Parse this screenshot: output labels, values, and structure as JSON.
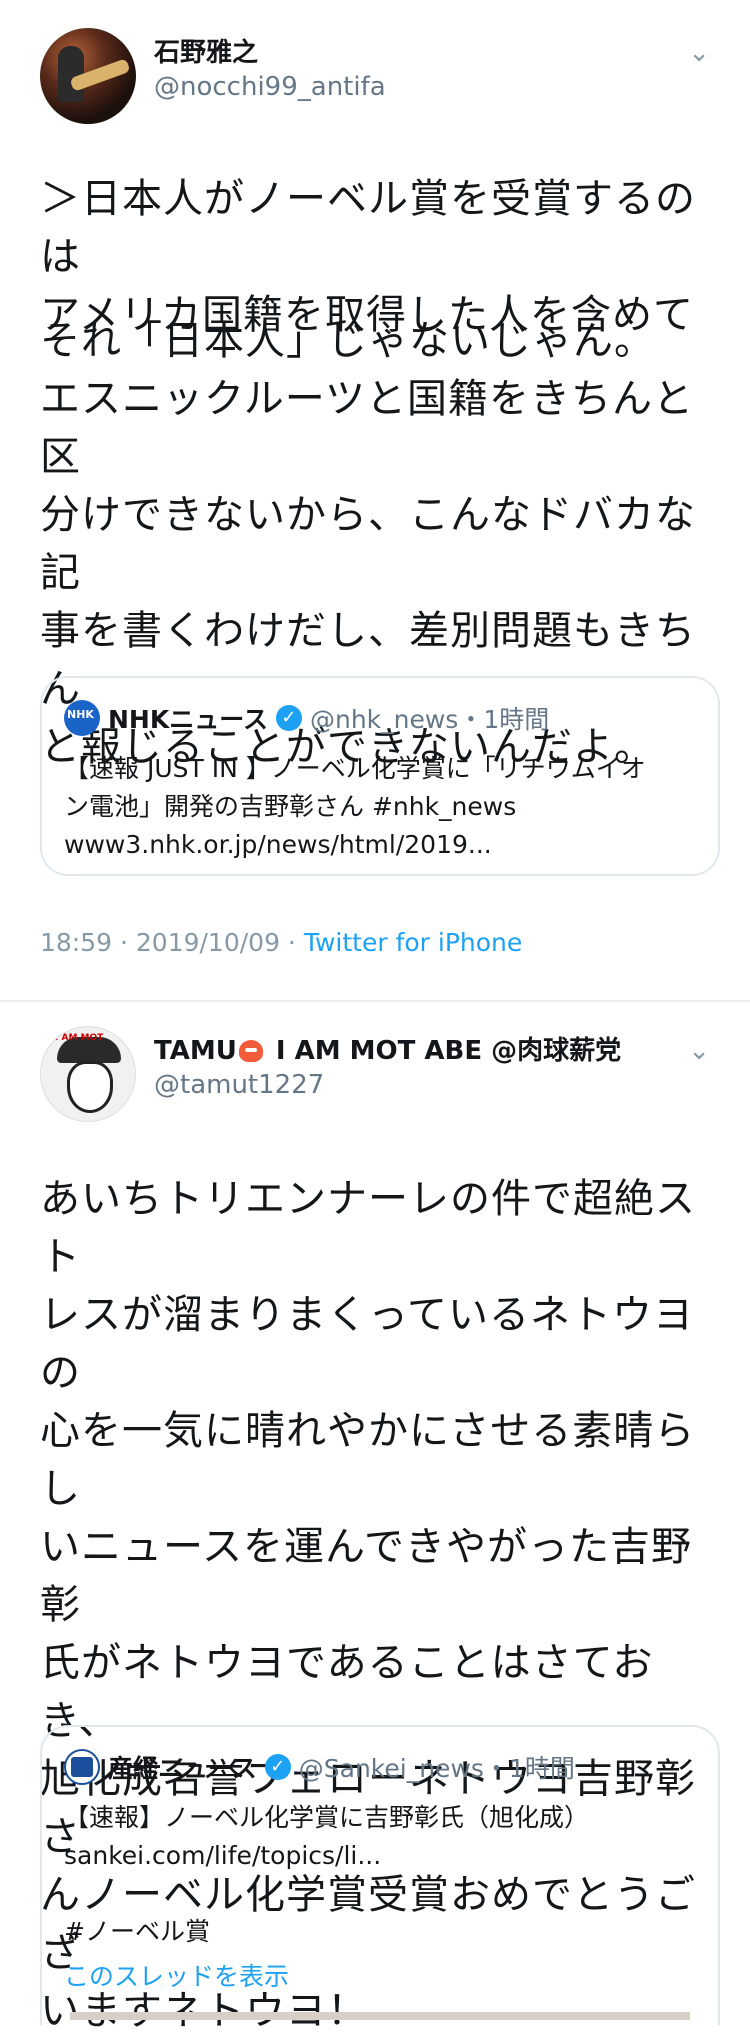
{
  "tweet1": {
    "name": "石野雅之",
    "handle": "@nocchi99_antifa",
    "para1": "＞日本人がノーベル賞を受賞するのは\nアメリカ国籍を取得した人を含めて",
    "para2": "それ「日本人」じゃないじゃん。\nエスニックルーツと国籍をきちんと区\n分けできないから、こんなドバカな記\n事を書くわけだし、差別問題もきちん\nと報じることができないんだよ。",
    "quote": {
      "logo_text": "NHK",
      "name": "NHKニュース",
      "handle": "@nhk_news・1時間",
      "body": "【速報 JUST IN 】ノーベル化学賞に「リチウムイオ\nン電池」開発の吉野彰さん #nhk_news\nwww3.nhk.or.jp/news/html/2019..."
    },
    "timestamp": "18:59 · 2019/10/09 · ",
    "client": "Twitter for iPhone"
  },
  "tweet2": {
    "name_prefix": "TAMU",
    "name_suffix": " I AM MOT ABE @肉球薪党",
    "handle": "@tamut1227",
    "avatar_text": "I AM MOT",
    "body": "あいちトリエンナーレの件で超絶スト\nレスが溜まりまくっているネトウヨの\n心を一気に晴れやかにさせる素晴らし\nいニュースを運んできやがった吉野彰\n氏がネトウヨであることはさておき、\n旭化成名誉フェローネトウヨ吉野彰さ\nんノーベル化学賞受賞おめでとうござ\nいますネトウヨ！",
    "quote": {
      "name": "産経ニュース",
      "handle": "@Sankei_news・1時間",
      "body": "【速報】ノーベル化学賞に吉野彰氏（旭化成）\nsankei.com/life/topics/li...",
      "hashtag": "#ノーベル賞",
      "thread_link": "このスレッドを表示"
    }
  },
  "icons": {
    "chevron": "chevron-down-icon",
    "verified": "verified-badge-icon",
    "octopus_emoji": "octopus-emoji-icon"
  },
  "colors": {
    "link": "#1da1f2",
    "muted": "#657786",
    "border": "#e1e8ed"
  }
}
